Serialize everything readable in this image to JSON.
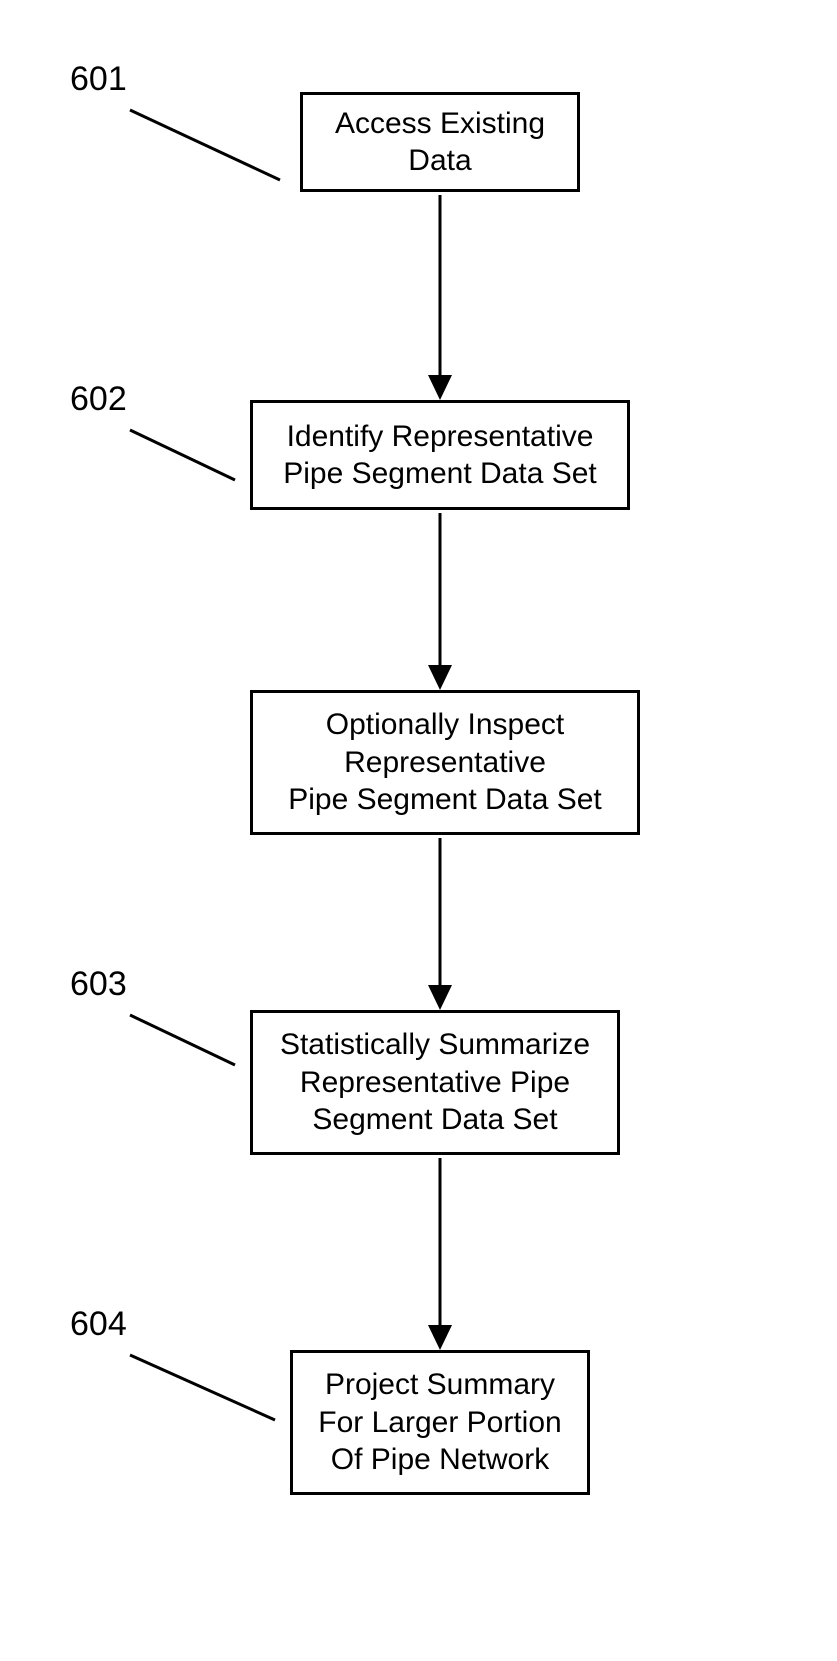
{
  "chart_data": {
    "type": "flowchart",
    "nodes": [
      {
        "id": "601",
        "ref": "601",
        "text": "Access Existing Data"
      },
      {
        "id": "602",
        "ref": "602",
        "text": "Identify Representative Pipe Segment Data Set"
      },
      {
        "id": "inspect",
        "ref": "",
        "text": "Optionally Inspect Representative Pipe Segment Data Set"
      },
      {
        "id": "603",
        "ref": "603",
        "text": "Statistically Summarize Representative Pipe Segment Data Set"
      },
      {
        "id": "604",
        "ref": "604",
        "text": "Project Summary For Larger Portion Of Pipe Network"
      }
    ],
    "edges": [
      {
        "from": "601",
        "to": "602"
      },
      {
        "from": "602",
        "to": "inspect"
      },
      {
        "from": "inspect",
        "to": "603"
      },
      {
        "from": "603",
        "to": "604"
      }
    ]
  },
  "labels": {
    "n601": "601",
    "n602": "602",
    "n603": "603",
    "n604": "604"
  },
  "boxes": {
    "b601": "Access Existing\nData",
    "b602": "Identify Representative\nPipe Segment Data Set",
    "bInspect": "Optionally Inspect\nRepresentative\nPipe Segment Data Set",
    "b603": "Statistically Summarize\nRepresentative Pipe\nSegment Data Set",
    "b604": "Project Summary\nFor Larger Portion\nOf Pipe Network"
  }
}
